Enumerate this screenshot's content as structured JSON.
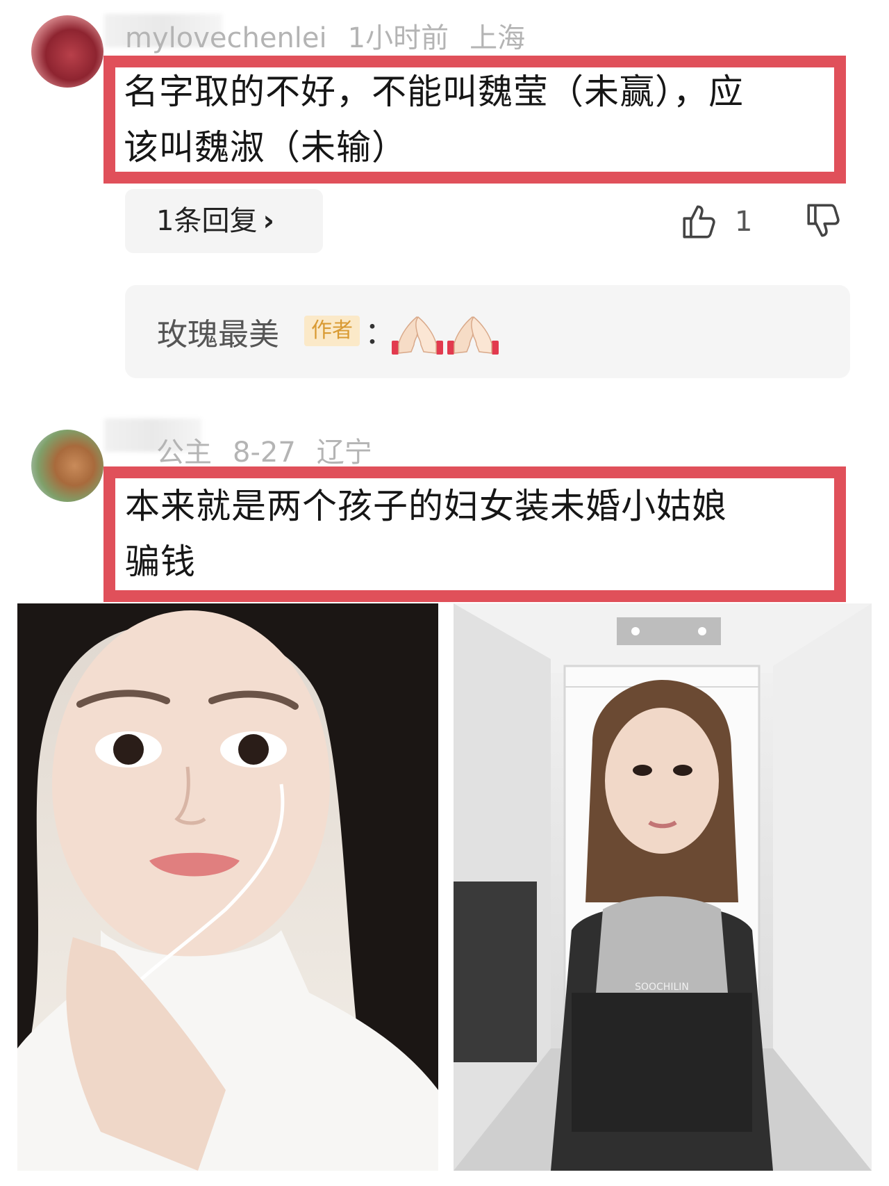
{
  "comments": [
    {
      "username": "mylovechenlei",
      "time": "1小时前",
      "location": "上海",
      "text_lines": [
        "名字取的不好，不能叫魏莹（未赢），应",
        "该叫魏淑（未输）"
      ],
      "reply_count_label": "1条回复",
      "like_count": "1"
    },
    {
      "username": "公主",
      "time": "8-27",
      "location": "辽宁",
      "text_lines": [
        "本来就是两个孩子的妇女装未婚小姑娘",
        "骗钱"
      ]
    }
  ],
  "author_reply": {
    "name": "玫瑰最美",
    "badge": "作者",
    "colon": "："
  },
  "photos": {
    "left_alt": "selfie",
    "right_shirt_text": "SOOCHILIN"
  },
  "colors": {
    "highlight_border": "#e0505a",
    "badge_bg": "#fbe9c8",
    "badge_text": "#d99a32"
  },
  "icons": [
    "thumbs-up-icon",
    "thumbs-down-icon",
    "chevron-right-icon",
    "praying-hands-icon"
  ]
}
